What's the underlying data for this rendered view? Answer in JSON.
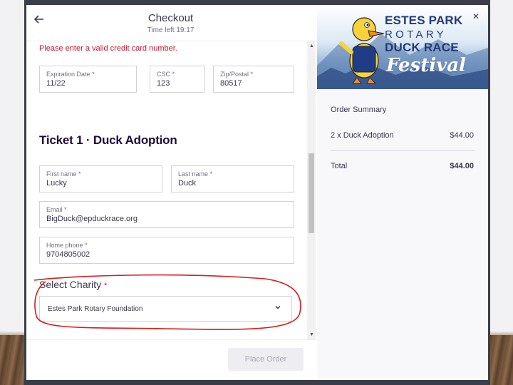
{
  "header": {
    "title": "Checkout",
    "timer": "Time left 19:17"
  },
  "form": {
    "error_message": "Please enter a valid credit card number.",
    "expiration": {
      "label": "Expiration Date",
      "value": "11/22"
    },
    "csc": {
      "label": "CSC",
      "value": "123"
    },
    "zip": {
      "label": "Zip/Postal",
      "value": "80517"
    },
    "required_mark": "*",
    "section_title": "Ticket 1 · Duck Adoption",
    "first_name": {
      "label": "First name",
      "value": "Lucky"
    },
    "last_name": {
      "label": "Last name",
      "value": "Duck"
    },
    "email": {
      "label": "Email",
      "value": "BigDuck@epduckrace.org"
    },
    "phone": {
      "label": "Home phone",
      "value": "9704805002"
    },
    "charity": {
      "label": "Select Charity",
      "value": "Estes Park Rotary Foundation"
    }
  },
  "footer": {
    "place_order_label": "Place Order"
  },
  "banner": {
    "line1": "ESTES PARK",
    "line2": "ROTARY",
    "line3": "DUCK RACE",
    "line4": "Festival",
    "close_icon": "close-icon"
  },
  "order_summary": {
    "title": "Order Summary",
    "item": "2 x Duck Adoption",
    "item_price": "$44.00",
    "total_label": "Total",
    "total_price": "$44.00"
  },
  "colors": {
    "accent_error": "#c5162e",
    "text_dark": "#39364f",
    "highlight_ink": "#d81d1d",
    "brand_blue": "#213a7a"
  }
}
